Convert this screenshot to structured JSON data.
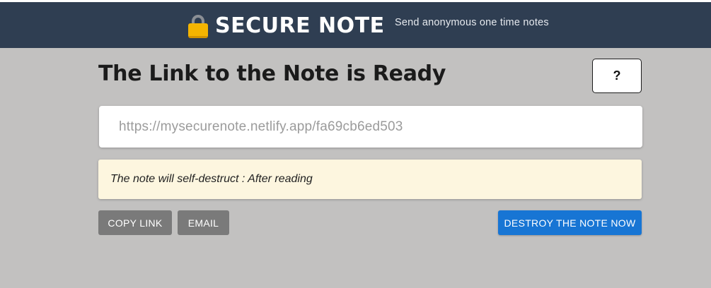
{
  "header": {
    "brand_title": "SECURE NOTE",
    "tagline": "Send anonymous one time notes",
    "logo_icon": "lock-icon"
  },
  "main": {
    "title": "The Link to the Note is Ready",
    "help_label": "?",
    "link_value": "https://mysecurenote.netlify.app/fa69cb6ed503",
    "notice_text": "The note will self-destruct : After reading"
  },
  "actions": {
    "copy_label": "COPY LINK",
    "email_label": "EMAIL",
    "destroy_label": "DESTROY THE NOTE NOW"
  },
  "colors": {
    "header_bg": "#2f3e52",
    "page_bg": "#c2c1c0",
    "notice_bg": "#fdf6df",
    "primary": "#1775d4",
    "secondary_button": "#7a7a7a",
    "lock_body": "#f4b400"
  }
}
